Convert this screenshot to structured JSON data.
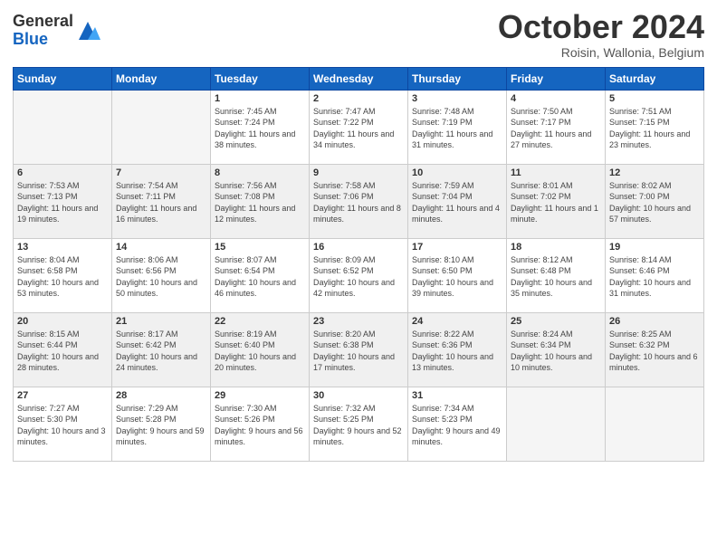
{
  "logo": {
    "general": "General",
    "blue": "Blue"
  },
  "title": "October 2024",
  "location": "Roisin, Wallonia, Belgium",
  "days_header": [
    "Sunday",
    "Monday",
    "Tuesday",
    "Wednesday",
    "Thursday",
    "Friday",
    "Saturday"
  ],
  "weeks": [
    [
      {
        "day": "",
        "sunrise": "",
        "sunset": "",
        "daylight": ""
      },
      {
        "day": "",
        "sunrise": "",
        "sunset": "",
        "daylight": ""
      },
      {
        "day": "1",
        "sunrise": "Sunrise: 7:45 AM",
        "sunset": "Sunset: 7:24 PM",
        "daylight": "Daylight: 11 hours and 38 minutes."
      },
      {
        "day": "2",
        "sunrise": "Sunrise: 7:47 AM",
        "sunset": "Sunset: 7:22 PM",
        "daylight": "Daylight: 11 hours and 34 minutes."
      },
      {
        "day": "3",
        "sunrise": "Sunrise: 7:48 AM",
        "sunset": "Sunset: 7:19 PM",
        "daylight": "Daylight: 11 hours and 31 minutes."
      },
      {
        "day": "4",
        "sunrise": "Sunrise: 7:50 AM",
        "sunset": "Sunset: 7:17 PM",
        "daylight": "Daylight: 11 hours and 27 minutes."
      },
      {
        "day": "5",
        "sunrise": "Sunrise: 7:51 AM",
        "sunset": "Sunset: 7:15 PM",
        "daylight": "Daylight: 11 hours and 23 minutes."
      }
    ],
    [
      {
        "day": "6",
        "sunrise": "Sunrise: 7:53 AM",
        "sunset": "Sunset: 7:13 PM",
        "daylight": "Daylight: 11 hours and 19 minutes."
      },
      {
        "day": "7",
        "sunrise": "Sunrise: 7:54 AM",
        "sunset": "Sunset: 7:11 PM",
        "daylight": "Daylight: 11 hours and 16 minutes."
      },
      {
        "day": "8",
        "sunrise": "Sunrise: 7:56 AM",
        "sunset": "Sunset: 7:08 PM",
        "daylight": "Daylight: 11 hours and 12 minutes."
      },
      {
        "day": "9",
        "sunrise": "Sunrise: 7:58 AM",
        "sunset": "Sunset: 7:06 PM",
        "daylight": "Daylight: 11 hours and 8 minutes."
      },
      {
        "day": "10",
        "sunrise": "Sunrise: 7:59 AM",
        "sunset": "Sunset: 7:04 PM",
        "daylight": "Daylight: 11 hours and 4 minutes."
      },
      {
        "day": "11",
        "sunrise": "Sunrise: 8:01 AM",
        "sunset": "Sunset: 7:02 PM",
        "daylight": "Daylight: 11 hours and 1 minute."
      },
      {
        "day": "12",
        "sunrise": "Sunrise: 8:02 AM",
        "sunset": "Sunset: 7:00 PM",
        "daylight": "Daylight: 10 hours and 57 minutes."
      }
    ],
    [
      {
        "day": "13",
        "sunrise": "Sunrise: 8:04 AM",
        "sunset": "Sunset: 6:58 PM",
        "daylight": "Daylight: 10 hours and 53 minutes."
      },
      {
        "day": "14",
        "sunrise": "Sunrise: 8:06 AM",
        "sunset": "Sunset: 6:56 PM",
        "daylight": "Daylight: 10 hours and 50 minutes."
      },
      {
        "day": "15",
        "sunrise": "Sunrise: 8:07 AM",
        "sunset": "Sunset: 6:54 PM",
        "daylight": "Daylight: 10 hours and 46 minutes."
      },
      {
        "day": "16",
        "sunrise": "Sunrise: 8:09 AM",
        "sunset": "Sunset: 6:52 PM",
        "daylight": "Daylight: 10 hours and 42 minutes."
      },
      {
        "day": "17",
        "sunrise": "Sunrise: 8:10 AM",
        "sunset": "Sunset: 6:50 PM",
        "daylight": "Daylight: 10 hours and 39 minutes."
      },
      {
        "day": "18",
        "sunrise": "Sunrise: 8:12 AM",
        "sunset": "Sunset: 6:48 PM",
        "daylight": "Daylight: 10 hours and 35 minutes."
      },
      {
        "day": "19",
        "sunrise": "Sunrise: 8:14 AM",
        "sunset": "Sunset: 6:46 PM",
        "daylight": "Daylight: 10 hours and 31 minutes."
      }
    ],
    [
      {
        "day": "20",
        "sunrise": "Sunrise: 8:15 AM",
        "sunset": "Sunset: 6:44 PM",
        "daylight": "Daylight: 10 hours and 28 minutes."
      },
      {
        "day": "21",
        "sunrise": "Sunrise: 8:17 AM",
        "sunset": "Sunset: 6:42 PM",
        "daylight": "Daylight: 10 hours and 24 minutes."
      },
      {
        "day": "22",
        "sunrise": "Sunrise: 8:19 AM",
        "sunset": "Sunset: 6:40 PM",
        "daylight": "Daylight: 10 hours and 20 minutes."
      },
      {
        "day": "23",
        "sunrise": "Sunrise: 8:20 AM",
        "sunset": "Sunset: 6:38 PM",
        "daylight": "Daylight: 10 hours and 17 minutes."
      },
      {
        "day": "24",
        "sunrise": "Sunrise: 8:22 AM",
        "sunset": "Sunset: 6:36 PM",
        "daylight": "Daylight: 10 hours and 13 minutes."
      },
      {
        "day": "25",
        "sunrise": "Sunrise: 8:24 AM",
        "sunset": "Sunset: 6:34 PM",
        "daylight": "Daylight: 10 hours and 10 minutes."
      },
      {
        "day": "26",
        "sunrise": "Sunrise: 8:25 AM",
        "sunset": "Sunset: 6:32 PM",
        "daylight": "Daylight: 10 hours and 6 minutes."
      }
    ],
    [
      {
        "day": "27",
        "sunrise": "Sunrise: 7:27 AM",
        "sunset": "Sunset: 5:30 PM",
        "daylight": "Daylight: 10 hours and 3 minutes."
      },
      {
        "day": "28",
        "sunrise": "Sunrise: 7:29 AM",
        "sunset": "Sunset: 5:28 PM",
        "daylight": "Daylight: 9 hours and 59 minutes."
      },
      {
        "day": "29",
        "sunrise": "Sunrise: 7:30 AM",
        "sunset": "Sunset: 5:26 PM",
        "daylight": "Daylight: 9 hours and 56 minutes."
      },
      {
        "day": "30",
        "sunrise": "Sunrise: 7:32 AM",
        "sunset": "Sunset: 5:25 PM",
        "daylight": "Daylight: 9 hours and 52 minutes."
      },
      {
        "day": "31",
        "sunrise": "Sunrise: 7:34 AM",
        "sunset": "Sunset: 5:23 PM",
        "daylight": "Daylight: 9 hours and 49 minutes."
      },
      {
        "day": "",
        "sunrise": "",
        "sunset": "",
        "daylight": ""
      },
      {
        "day": "",
        "sunrise": "",
        "sunset": "",
        "daylight": ""
      }
    ]
  ]
}
